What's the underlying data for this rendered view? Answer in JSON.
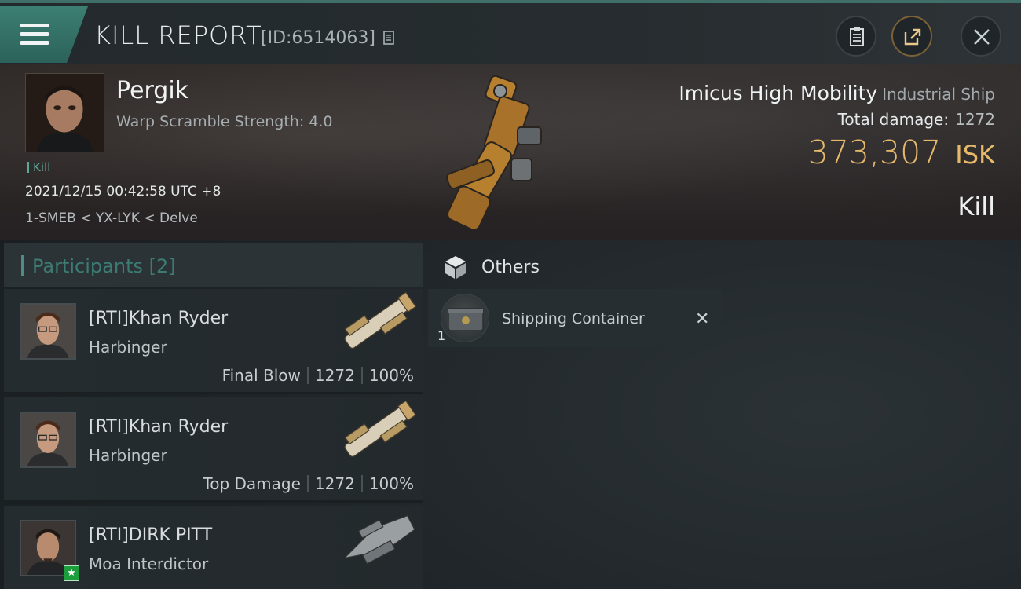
{
  "header": {
    "title": "KILL REPORT",
    "report_id": "[ID:6514063]",
    "buttons": {
      "menu": "menu-icon",
      "notes": "notepad-icon",
      "share": "share-icon",
      "close": "close-icon"
    }
  },
  "victim": {
    "name": "Pergik",
    "warp_scramble": "Warp Scramble Strength: 4.0",
    "tag": "Kill",
    "datetime": "2021/12/15 00:42:58 UTC +8",
    "location": "1-SMEB < YX-LYK < Delve",
    "ship_name": "Imicus High Mobility",
    "ship_class": "Industrial Ship",
    "total_damage_label": "Total damage:",
    "total_damage_value": "1272",
    "isk_amount": "373,307",
    "isk_currency": "ISK",
    "result": "Kill"
  },
  "participants": {
    "header": "Participants [2]",
    "rows": [
      {
        "name": "[RTI]Khan Ryder",
        "ship": "Harbinger",
        "role": "Final Blow",
        "damage": "1272",
        "percent": "100%"
      },
      {
        "name": "[RTI]Khan Ryder",
        "ship": "Harbinger",
        "role": "Top Damage",
        "damage": "1272",
        "percent": "100%"
      },
      {
        "name": "[RTI]DIRK PITT",
        "ship": "Moa Interdictor",
        "badge": "★"
      }
    ]
  },
  "others": {
    "header": "Others",
    "items": [
      {
        "name": "Shipping Container",
        "qty": "1"
      }
    ]
  },
  "colors": {
    "accent_teal": "#3c7f73",
    "isk_gold": "#e6b96a"
  }
}
